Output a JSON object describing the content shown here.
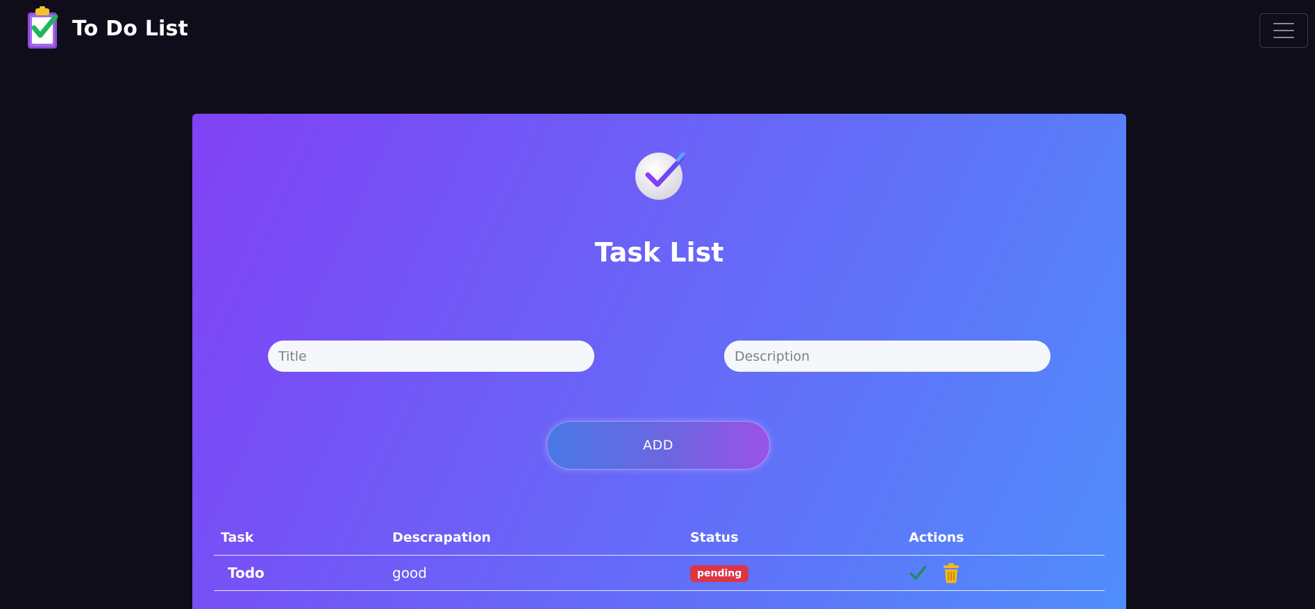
{
  "navbar": {
    "brand_title": "To Do List",
    "logo_icon": "clipboard-check-icon",
    "menu_icon": "hamburger-menu-icon"
  },
  "card": {
    "icon": "check-circle-icon",
    "title": "Task List",
    "title_placeholder": "Title",
    "description_placeholder": "Description",
    "add_label": "ADD"
  },
  "table": {
    "headers": [
      "Task",
      "Descrapation",
      "Status",
      "Actions"
    ],
    "rows": [
      {
        "task": "Todo",
        "description": "good",
        "status": "pending",
        "actions": [
          "complete-check-icon",
          "delete-trash-icon"
        ]
      }
    ]
  },
  "colors": {
    "page_background": "#100d1b",
    "card_gradient_start": "#8142f5",
    "card_gradient_end": "#4f8dfb",
    "status_pending": "#dc3545",
    "complete_action": "#1f8a5a",
    "delete_action": "#f5b81c"
  }
}
